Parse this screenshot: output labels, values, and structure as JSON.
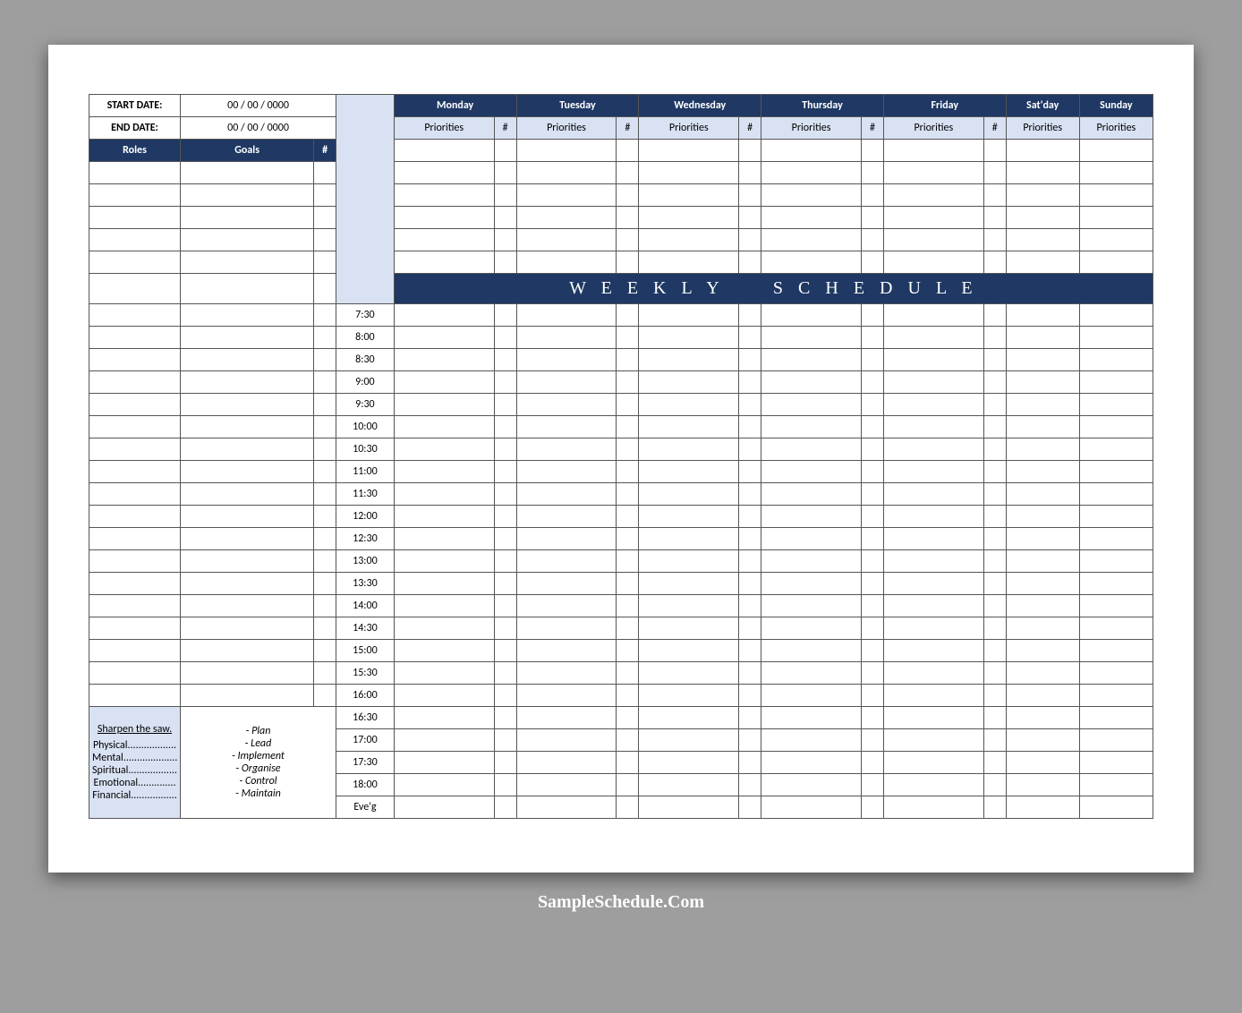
{
  "dates": {
    "start_label": "START DATE:",
    "start_value": "00 / 00 / 0000",
    "end_label": "END DATE:",
    "end_value": "00 / 00 / 0000"
  },
  "left_headers": {
    "roles": "Roles",
    "goals": "Goals",
    "num": "#"
  },
  "days": [
    "Monday",
    "Tuesday",
    "Wednesday",
    "Thursday",
    "Friday",
    "Sat'day",
    "Sunday"
  ],
  "sub": {
    "priorities": "Priorities",
    "num": "#"
  },
  "banner": "W E E K L Y     S C H E D U L E",
  "times": [
    "7:30",
    "8:00",
    "8:30",
    "9:00",
    "9:30",
    "10:00",
    "10:30",
    "11:00",
    "11:30",
    "12:00",
    "12:30",
    "13:00",
    "13:30",
    "14:00",
    "14:30",
    "15:00",
    "15:30",
    "16:00",
    "16:30",
    "17:00",
    "17:30",
    "18:00",
    "Eve'g"
  ],
  "sharpen": {
    "title": "Sharpen the saw.",
    "cats": [
      "Physical..................",
      "Mental....................",
      "Spiritual..................",
      "Emotional..............",
      "Financial................."
    ],
    "actions": [
      "Plan",
      "Lead",
      "Implement",
      "Organise",
      "Control",
      "Maintain"
    ]
  },
  "footer": "SampleSchedule.Com"
}
